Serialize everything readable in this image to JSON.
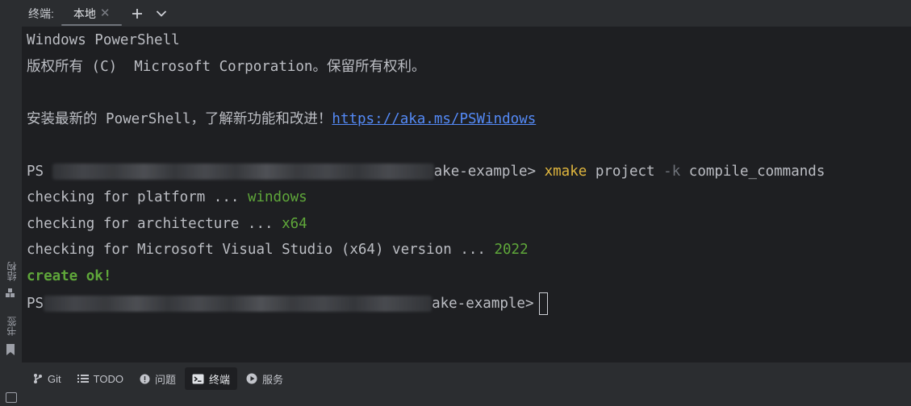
{
  "header": {
    "title": "终端:",
    "tab_label": "本地",
    "tab_close": "✕"
  },
  "sidebar": {
    "structure_label": "结构",
    "bookmarks_label": "书签"
  },
  "terminal": {
    "line1": "Windows PowerShell",
    "line2": "版权所有 (C)  Microsoft Corporation。保留所有权利。",
    "line4_prefix": "安装最新的 PowerShell，了解新功能和改进！",
    "line4_link": "https://aka.ms/PSWindows",
    "prompt1": {
      "ps": "PS",
      "path_tail": "ake-example>",
      "cmd": "xmake",
      "arg1": "project",
      "flag": "-k",
      "arg2": "compile_commands"
    },
    "check1": {
      "label": "checking for platform ... ",
      "value": "windows"
    },
    "check2": {
      "label": "checking for architecture ... ",
      "value": "x64"
    },
    "check3": {
      "label": "checking for Microsoft Visual Studio (x64) version ... ",
      "value": "2022"
    },
    "done": "create ok!",
    "prompt2": {
      "ps": "PS",
      "path_tail": "ake-example>"
    }
  },
  "bottombar": {
    "git": "Git",
    "todo": "TODO",
    "problems": "问题",
    "terminal": "终端",
    "services": "服务"
  },
  "colors": {
    "terminal_bg": "#1e1f22",
    "chrome_bg": "#2b2d30",
    "command": "#e0b63e",
    "success": "#5fa73a",
    "link": "#548af7"
  }
}
